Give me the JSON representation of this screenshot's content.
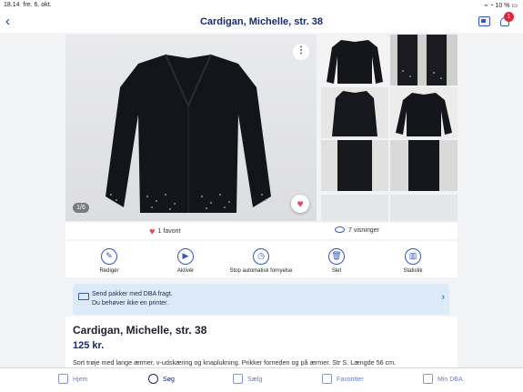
{
  "status": {
    "time": "18.14",
    "date": "fre. 6. okt.",
    "battery": "10 %"
  },
  "header": {
    "title": "Cardigan, Michelle, str. 38",
    "notification_count": "1"
  },
  "gallery": {
    "counter": "1/6",
    "more": "⋮"
  },
  "stats": {
    "favorites": "1 favorit",
    "views": "7 visninger"
  },
  "actions": [
    {
      "label": "Redigér",
      "icon": "pencil-icon"
    },
    {
      "label": "Aktivér",
      "icon": "play-icon"
    },
    {
      "label": "Stop automatisk fornyelse",
      "icon": "timer-icon"
    },
    {
      "label": "Slet",
      "icon": "trash-icon"
    },
    {
      "label": "Statistik",
      "icon": "chart-icon"
    }
  ],
  "banner": {
    "line1": "Send pakker med DBA fragt.",
    "line2": "Du behøver ikke en printer."
  },
  "listing": {
    "title": "Cardigan, Michelle, str. 38",
    "price": "125 kr.",
    "description": "Sort trøje med lange ærmer, v-udskæring og knaplukning. Prikker forneden og på ærmer. Str S. Længde 56 cm."
  },
  "tabs": [
    {
      "label": "Hjem",
      "icon": "home-icon"
    },
    {
      "label": "Søg",
      "icon": "search-icon"
    },
    {
      "label": "Sælg",
      "icon": "sell-icon"
    },
    {
      "label": "Favoritter",
      "icon": "heart-icon"
    },
    {
      "label": "Min DBA",
      "icon": "profile-icon"
    }
  ],
  "colors": {
    "brand": "#172a6b",
    "accent": "#3457b8",
    "favorite": "#e3485e",
    "banner": "#dce9f8"
  }
}
